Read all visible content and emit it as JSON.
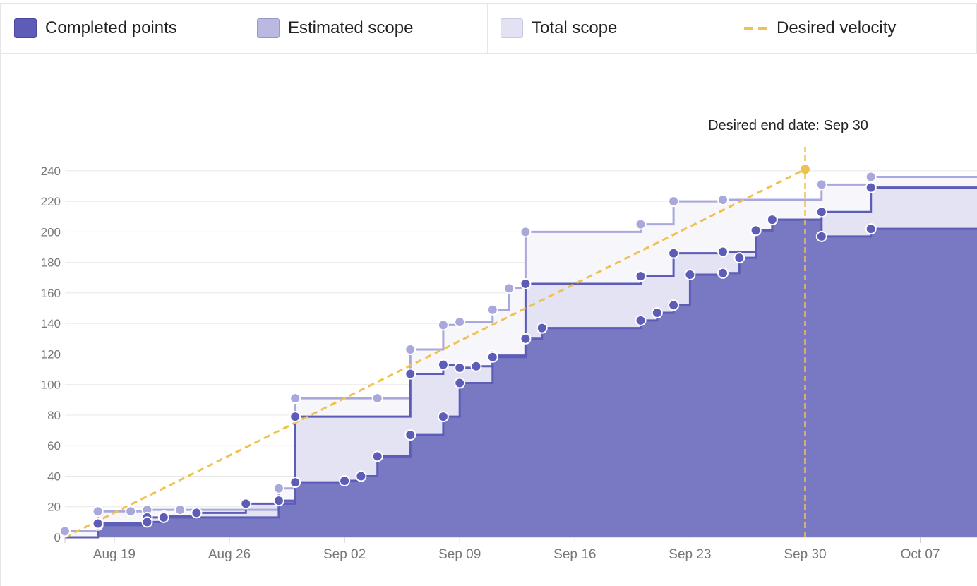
{
  "legend": {
    "items": [
      {
        "label": "Completed points",
        "fill": "#5d5cb6",
        "border": "#4a499e"
      },
      {
        "label": "Estimated scope",
        "fill": "#b9b9e1",
        "border": "#9897d0"
      },
      {
        "label": "Total scope",
        "fill": "#e2e2f3",
        "border": "#c8c8e6"
      },
      {
        "label": "Desired velocity",
        "color": "#eec24f"
      }
    ]
  },
  "colors": {
    "completed": "#5d5cb6",
    "completed_fill": "#7978c2",
    "estimated": "#a9a8dc",
    "estimated_fill": "#e3e3f4",
    "total_fill": "#f7f7fb",
    "velocity": "#eec24f",
    "grid": "#e8e8e8",
    "tick_text": "#777777"
  },
  "chart_data": {
    "type": "area",
    "x_axis": {
      "type": "date",
      "range": [
        "Aug 16",
        "Oct 11"
      ],
      "ticks": [
        {
          "date": "Aug 19",
          "label": "Aug 19"
        },
        {
          "date": "Aug 26",
          "label": "Aug 26"
        },
        {
          "date": "Sep 02",
          "label": "Sep 02"
        },
        {
          "date": "Sep 09",
          "label": "Sep 09"
        },
        {
          "date": "Sep 16",
          "label": "Sep 16"
        },
        {
          "date": "Sep 23",
          "label": "Sep 23"
        },
        {
          "date": "Sep 30",
          "label": "Sep 30"
        },
        {
          "date": "Oct 07",
          "label": "Oct 07"
        }
      ]
    },
    "y_axis": {
      "range": [
        0,
        250
      ],
      "ticks": [
        0,
        20,
        40,
        60,
        80,
        100,
        120,
        140,
        160,
        180,
        200,
        220,
        240
      ]
    },
    "grid": true,
    "series": [
      {
        "name": "Total scope",
        "type": "step",
        "points": [
          [
            "Aug 16",
            4
          ],
          [
            "Aug 18",
            17
          ],
          [
            "Aug 20",
            17
          ],
          [
            "Aug 21",
            18
          ],
          [
            "Aug 23",
            18
          ],
          [
            "Aug 29",
            32
          ],
          [
            "Aug 30",
            91
          ],
          [
            "Sep 04",
            91
          ],
          [
            "Sep 06",
            123
          ],
          [
            "Sep 08",
            139
          ],
          [
            "Sep 09",
            141
          ],
          [
            "Sep 11",
            149
          ],
          [
            "Sep 12",
            163
          ],
          [
            "Sep 13",
            200
          ],
          [
            "Sep 20",
            205
          ],
          [
            "Sep 22",
            220
          ],
          [
            "Sep 25",
            221
          ],
          [
            "Oct 01",
            231
          ],
          [
            "Oct 04",
            236
          ],
          [
            "Oct 11",
            236
          ]
        ]
      },
      {
        "name": "Estimated scope",
        "type": "step",
        "points": [
          [
            "Aug 16",
            0
          ],
          [
            "Aug 18",
            8
          ],
          [
            "Aug 21",
            13
          ],
          [
            "Aug 22",
            14
          ],
          [
            "Aug 24",
            16
          ],
          [
            "Aug 27",
            22
          ],
          [
            "Aug 30",
            79
          ],
          [
            "Sep 06",
            107
          ],
          [
            "Sep 08",
            113
          ],
          [
            "Sep 09",
            111
          ],
          [
            "Sep 10",
            112
          ],
          [
            "Sep 11",
            119
          ],
          [
            "Sep 13",
            166
          ],
          [
            "Sep 20",
            171
          ],
          [
            "Sep 22",
            186
          ],
          [
            "Sep 25",
            187
          ],
          [
            "Sep 27",
            201
          ],
          [
            "Sep 28",
            208
          ],
          [
            "Oct 01",
            213
          ],
          [
            "Oct 04",
            229
          ],
          [
            "Oct 11",
            229
          ]
        ]
      },
      {
        "name": "Completed points",
        "type": "step",
        "points": [
          [
            "Aug 16",
            0
          ],
          [
            "Aug 18",
            9
          ],
          [
            "Aug 21",
            10
          ],
          [
            "Aug 22",
            13
          ],
          [
            "Aug 29",
            24
          ],
          [
            "Aug 30",
            36
          ],
          [
            "Sep 02",
            37
          ],
          [
            "Sep 03",
            40
          ],
          [
            "Sep 04",
            53
          ],
          [
            "Sep 06",
            67
          ],
          [
            "Sep 08",
            79
          ],
          [
            "Sep 09",
            101
          ],
          [
            "Sep 11",
            118
          ],
          [
            "Sep 13",
            130
          ],
          [
            "Sep 14",
            137
          ],
          [
            "Sep 20",
            142
          ],
          [
            "Sep 21",
            147
          ],
          [
            "Sep 22",
            152
          ],
          [
            "Sep 23",
            172
          ],
          [
            "Sep 25",
            173
          ],
          [
            "Sep 26",
            183
          ],
          [
            "Sep 27",
            201
          ],
          [
            "Sep 28",
            208
          ],
          [
            "Oct 01",
            197
          ],
          [
            "Oct 04",
            202
          ],
          [
            "Oct 11",
            202
          ]
        ]
      }
    ],
    "desired_velocity": {
      "start": [
        "Aug 16",
        0
      ],
      "end": [
        "Sep 30",
        241
      ]
    },
    "annotations": [
      {
        "date": "Sep 30",
        "value": 241,
        "text": "Desired end date: Sep 30"
      }
    ]
  }
}
